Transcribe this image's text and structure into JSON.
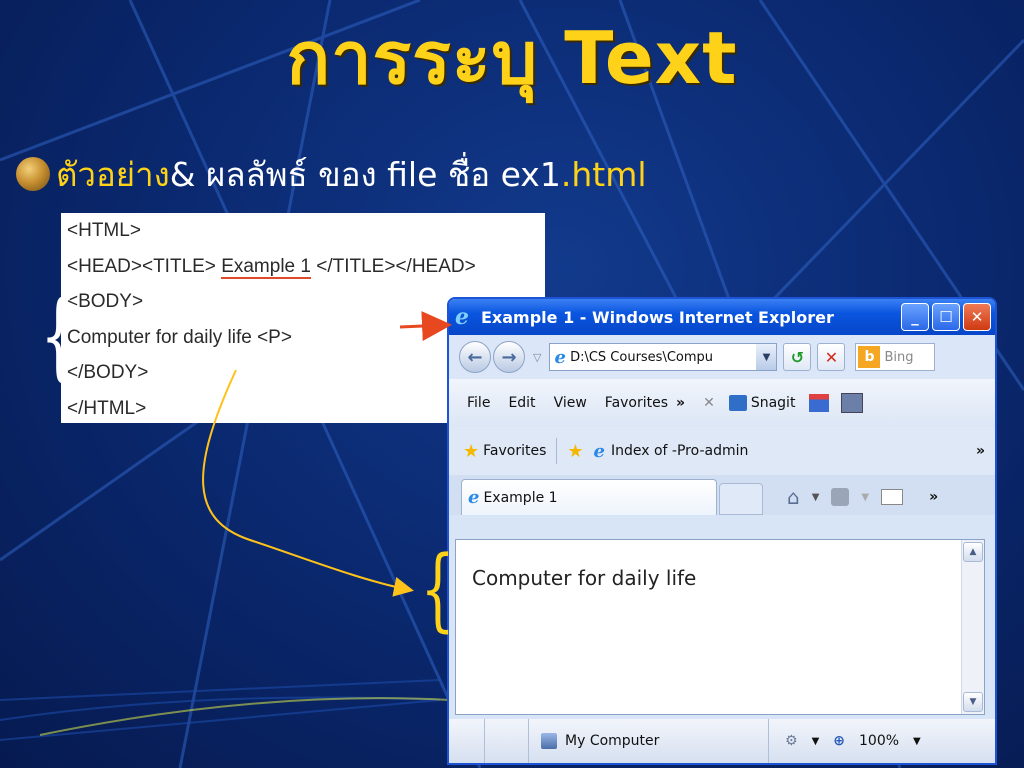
{
  "slide": {
    "title": "การระบุ Text",
    "bullet": {
      "part1": "ตัวอย่าง",
      "part2": " & ผลลัพธ์ ของ file ชื่อ ex1",
      "part3": ".html"
    }
  },
  "code_lines": [
    "<HTML>",
    "<HEAD><TITLE> ",
    "Example 1",
    " </TITLE></HEAD>",
    "<BODY>",
    "Computer for daily life <P>",
    "</BODY>",
    "</HTML>"
  ],
  "ie": {
    "window_title": "Example 1 - Windows Internet Explorer",
    "address": "D:\\CS Courses\\Compu",
    "search_provider": "Bing",
    "menu": [
      "File",
      "Edit",
      "View",
      "Favorites"
    ],
    "menu_overflow": "»",
    "toolbar_snagit": "Snagit",
    "favorites_label": "Favorites",
    "favorite_link": "Index of -Pro-admin",
    "tab_title": "Example 1",
    "page_text": "Computer for daily life",
    "status_zone": "My Computer",
    "zoom": "100%"
  },
  "colors": {
    "background": "#0b2a72",
    "title": "#ffd21a",
    "arrow_red": "#e8481f",
    "arrow_yellow": "#ffc21a"
  },
  "icons": [
    "ie-logo-icon",
    "back-icon",
    "forward-icon",
    "refresh-icon",
    "stop-icon",
    "bing-icon",
    "favorites-star-icon",
    "home-icon",
    "rss-icon",
    "mail-icon",
    "scroll-up-icon",
    "scroll-down-icon",
    "computer-icon",
    "zoom-icon"
  ]
}
